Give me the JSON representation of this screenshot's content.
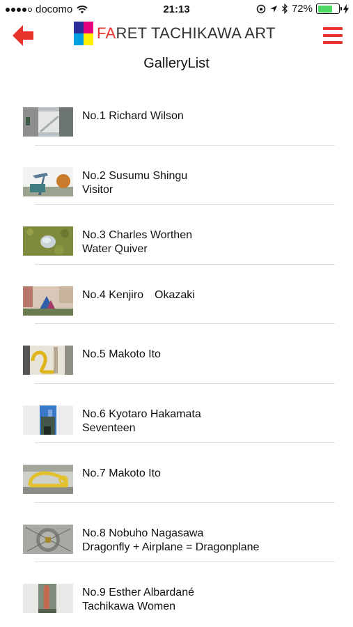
{
  "status_bar": {
    "carrier": "docomo",
    "time": "21:13",
    "battery": "72%",
    "battery_level": 0.72,
    "signal_bars": 4,
    "battery_color": "#4cd964"
  },
  "header": {
    "brand_accent": "FA",
    "brand_rest": "RET TACHIKAWA ART",
    "back_icon": "back-arrow-icon",
    "menu_icon": "hamburger-menu-icon",
    "accent_color": "#e8332a"
  },
  "page": {
    "title": "GalleryList"
  },
  "gallery": [
    {
      "line1": "No.1 Richard Wilson",
      "line2": ""
    },
    {
      "line1": "No.2 Susumu Shingu",
      "line2": "Visitor"
    },
    {
      "line1": "No.3 Charles Worthen",
      "line2": "Water Quiver"
    },
    {
      "line1": "No.4 Kenjiro　Okazaki",
      "line2": ""
    },
    {
      "line1": "No.5 Makoto Ito",
      "line2": ""
    },
    {
      "line1": "No.6 Kyotaro Hakamata",
      "line2": "Seventeen"
    },
    {
      "line1": "No.7 Makoto Ito",
      "line2": ""
    },
    {
      "line1": "No.8 Nobuho Nagasawa",
      "line2": "Dragonfly + Airplane = Dragonplane"
    },
    {
      "line1": "No.9 Esther Albardané",
      "line2": "Tachikawa Women"
    }
  ]
}
